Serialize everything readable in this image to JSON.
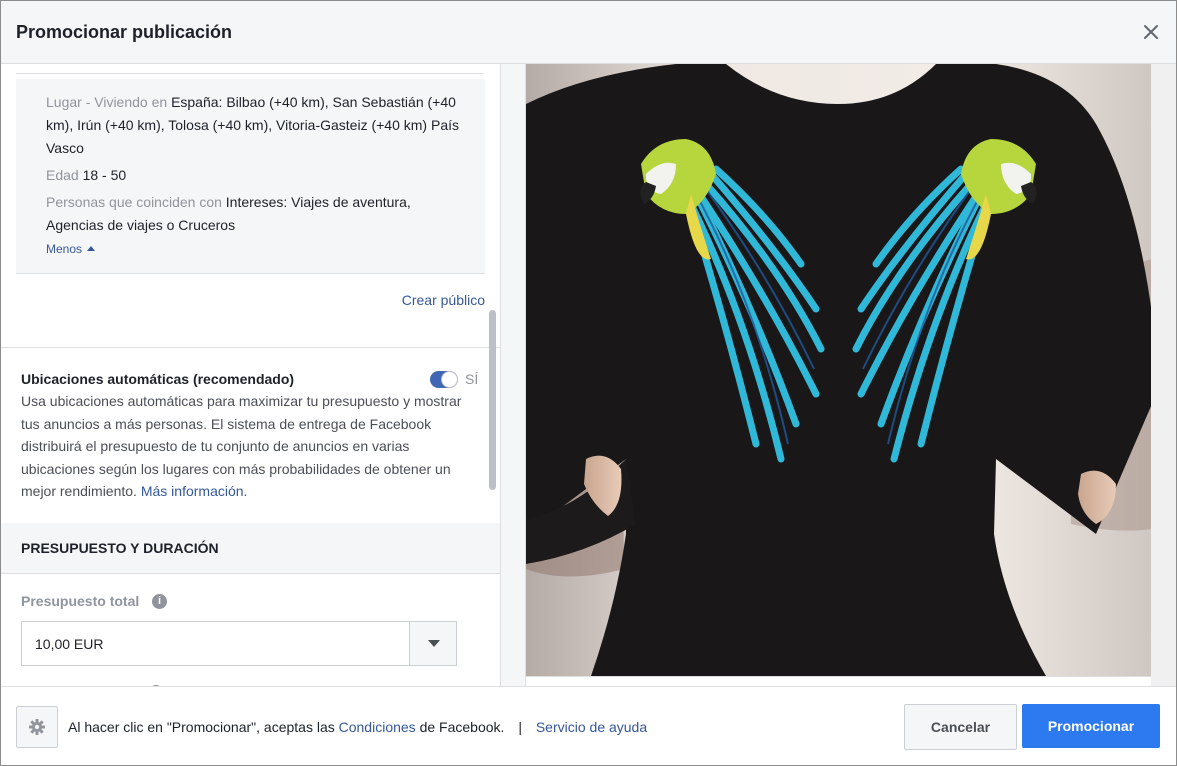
{
  "header": {
    "title": "Promocionar publicación"
  },
  "audience": {
    "location_label": "Lugar - Viviendo en",
    "location_value": "España: Bilbao (+40 km), San Sebastián (+40 km), Irún (+40 km), Tolosa (+40 km), Vitoria-Gasteiz (+40 km) País Vasco",
    "age_label": "Edad",
    "age_value": "18 - 50",
    "interests_label": "Personas que coinciden con",
    "interests_value": "Intereses: Viajes de aventura, Agencias de viajes o Cruceros",
    "less_link": "Menos",
    "create_audience_link": "Crear público"
  },
  "placements": {
    "title": "Ubicaciones automáticas (recomendado)",
    "toggle_state": "SÍ",
    "toggle_on": true,
    "description": "Usa ubicaciones automáticas para maximizar tu presupuesto y mostrar tus anuncios a más personas. El sistema de entrega de Facebook distribuirá el presupuesto de tu conjunto de anuncios en varias ubicaciones según los lugares con más probabilidades de obtener un mejor rendimiento.",
    "more_info_link": "Más información."
  },
  "budget": {
    "section_title": "PRESUPUESTO Y DURACIÓN",
    "total_label": "Presupuesto total",
    "total_value": "10,00 EUR"
  },
  "footer": {
    "text_before": "Al hacer clic en \"Promocionar\", aceptas las",
    "conditions_link": "Condiciones",
    "text_after": "de Facebook.",
    "separator": "|",
    "help_link": "Servicio de ayuda",
    "cancel_button": "Cancelar",
    "promote_button": "Promocionar"
  },
  "icons": {
    "close": "close-icon",
    "caret_up": "caret-up-icon",
    "info": "info-icon",
    "dropdown": "chevron-down-icon",
    "settings": "gear-icon"
  },
  "colors": {
    "link": "#365899",
    "primary_button": "#2d7af0",
    "toggle_on": "#4267b2",
    "muted_text": "#90949c",
    "panel_bg": "#f5f6f7"
  }
}
